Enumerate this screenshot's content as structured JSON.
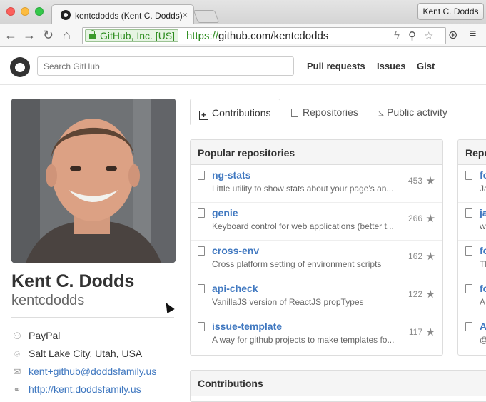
{
  "browser": {
    "tab_title": "kentcdodds (Kent C. Dodds)",
    "tab_close": "×",
    "profile_name": "Kent C. Dodds",
    "ev_label": "GitHub, Inc. [US]",
    "url_scheme": "https://",
    "url_rest": "github.com/kentcdodds",
    "back": "←",
    "forward": "→",
    "reload": "↻",
    "home": "⌂"
  },
  "github": {
    "search_placeholder": "Search GitHub",
    "nav": [
      "Pull requests",
      "Issues",
      "Gist"
    ]
  },
  "profile": {
    "full_name": "Kent C. Dodds",
    "username": "kentcdodds",
    "company": "PayPal",
    "location": "Salt Lake City, Utah, USA",
    "email": "kent+github@doddsfamily.us",
    "website": "http://kent.doddsfamily.us"
  },
  "tabs": [
    "Contributions",
    "Repositories",
    "Public activity"
  ],
  "popular": {
    "title": "Popular repositories",
    "repos": [
      {
        "name": "ng-stats",
        "desc": "Little utility to show stats about your page's an...",
        "stars": "453"
      },
      {
        "name": "genie",
        "desc": "Keyboard control for web applications (better t...",
        "stars": "266"
      },
      {
        "name": "cross-env",
        "desc": "Cross platform setting of environment scripts",
        "stars": "162"
      },
      {
        "name": "api-check",
        "desc": "VanillaJS version of ReactJS propTypes",
        "stars": "122"
      },
      {
        "name": "issue-template",
        "desc": "A way for github projects to make templates fo...",
        "stars": "117"
      }
    ]
  },
  "contributed": {
    "title": "Repo",
    "repos": [
      {
        "name": "fo",
        "desc": "Ja"
      },
      {
        "name": "ja",
        "desc": "wl"
      },
      {
        "name": "fo",
        "desc": "Th"
      },
      {
        "name": "fo",
        "desc": "A"
      },
      {
        "name": "A",
        "desc": "@"
      }
    ]
  },
  "contributions_title": "Contributions"
}
